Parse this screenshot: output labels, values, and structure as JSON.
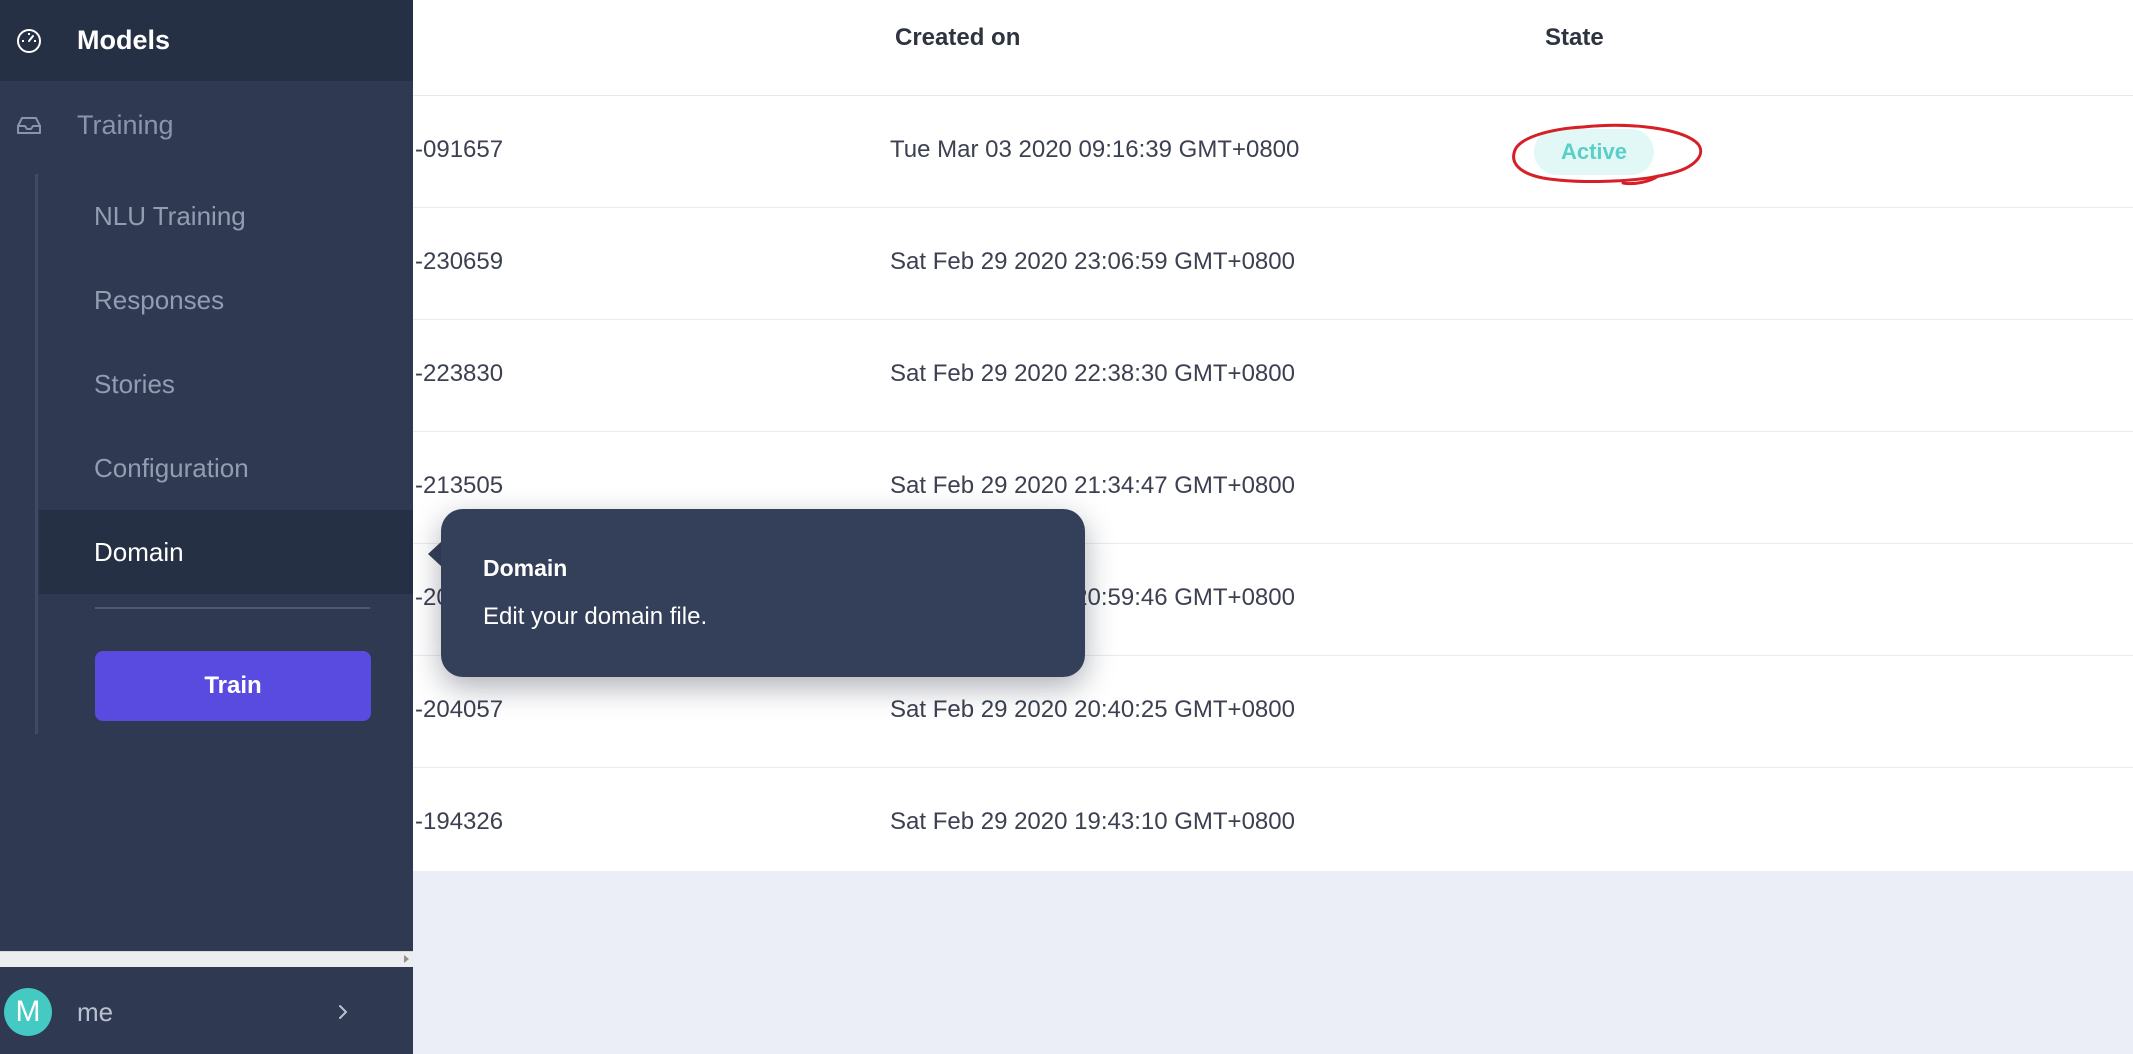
{
  "sidebar": {
    "models_label": "Models",
    "models_icon": "dashboard-gauge-icon",
    "training_label": "Training",
    "training_icon": "inbox-icon",
    "sub_items": [
      {
        "label": "NLU Training"
      },
      {
        "label": "Responses"
      },
      {
        "label": "Stories"
      },
      {
        "label": "Configuration"
      },
      {
        "label": "Domain",
        "active": true
      }
    ],
    "train_button": "Train",
    "user": {
      "initial": "M",
      "name": "me",
      "chevron_icon": "chevron-right-icon"
    }
  },
  "table": {
    "headers": {
      "created_on": "Created on",
      "state": "State"
    },
    "rows": [
      {
        "name": "-091657",
        "created": "Tue Mar 03 2020 09:16:39 GMT+0800",
        "state": "Active"
      },
      {
        "name": "-230659",
        "created": "Sat Feb 29 2020 23:06:59 GMT+0800",
        "state": ""
      },
      {
        "name": "-223830",
        "created": "Sat Feb 29 2020 22:38:30 GMT+0800",
        "state": ""
      },
      {
        "name": "-213505",
        "created": "Sat Feb 29 2020 21:34:47 GMT+0800",
        "state": ""
      },
      {
        "name": "-205946",
        "created": "Sat Feb 29 2020 20:59:46 GMT+0800",
        "state": ""
      },
      {
        "name": "-204057",
        "created": "Sat Feb 29 2020 20:40:25 GMT+0800",
        "state": ""
      },
      {
        "name": "-194326",
        "created": "Sat Feb 29 2020 19:43:10 GMT+0800",
        "state": ""
      }
    ]
  },
  "tooltip": {
    "title": "Domain",
    "body": "Edit your domain file."
  },
  "colors": {
    "sidebar_bg": "#2f3a52",
    "sidebar_active_bg": "#263044",
    "train_button": "#5a4be0",
    "active_badge_text": "#5acfc8",
    "active_badge_bg": "#e2f8f7",
    "annotation_red": "#d61f26",
    "page_bg": "#ebeef7"
  }
}
